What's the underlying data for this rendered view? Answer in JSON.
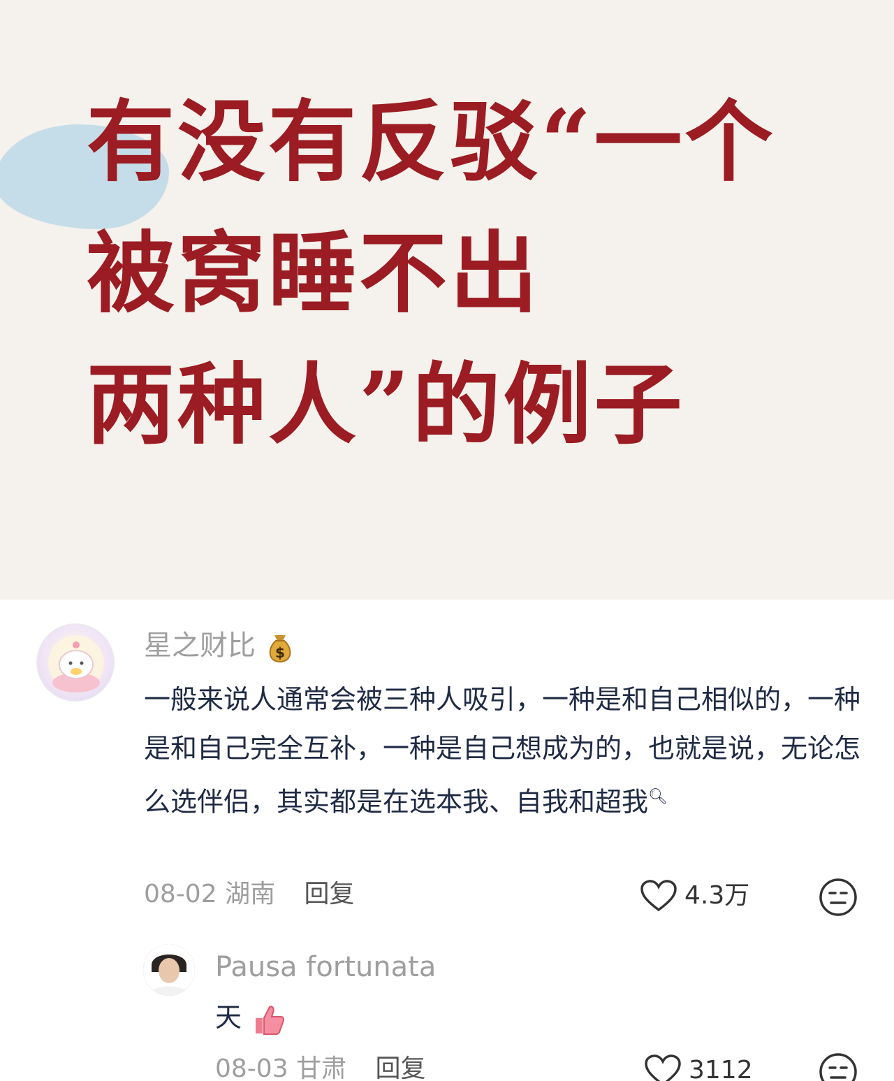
{
  "cover": {
    "line1": "有没有反驳“一个",
    "line2": "被窝睡不出",
    "line3": "两种人”的例子"
  },
  "comment1": {
    "username": "星之财比",
    "text": "一般来说人通常会被三种人吸引，一种是和自己相似的，一种是和自己完全互补，一种是自己想成为的，也就是说，无论怎么选伴侣，其实都是在选本我、自我和超我",
    "date": "08-02",
    "location": "湖南",
    "reply_label": "回复",
    "likes": "4.3万"
  },
  "comment2": {
    "username": "Pausa fortunata",
    "text": "天",
    "date": "08-03",
    "location": "甘肃",
    "reply_label": "回复",
    "likes": "3112"
  },
  "colors": {
    "title_red": "#9b1c22",
    "highlight_blue": "#bcd9e8",
    "cover_bg": "#f5f1ec",
    "comment_text": "#1f2a44",
    "meta_gray": "#9e9e9e"
  }
}
